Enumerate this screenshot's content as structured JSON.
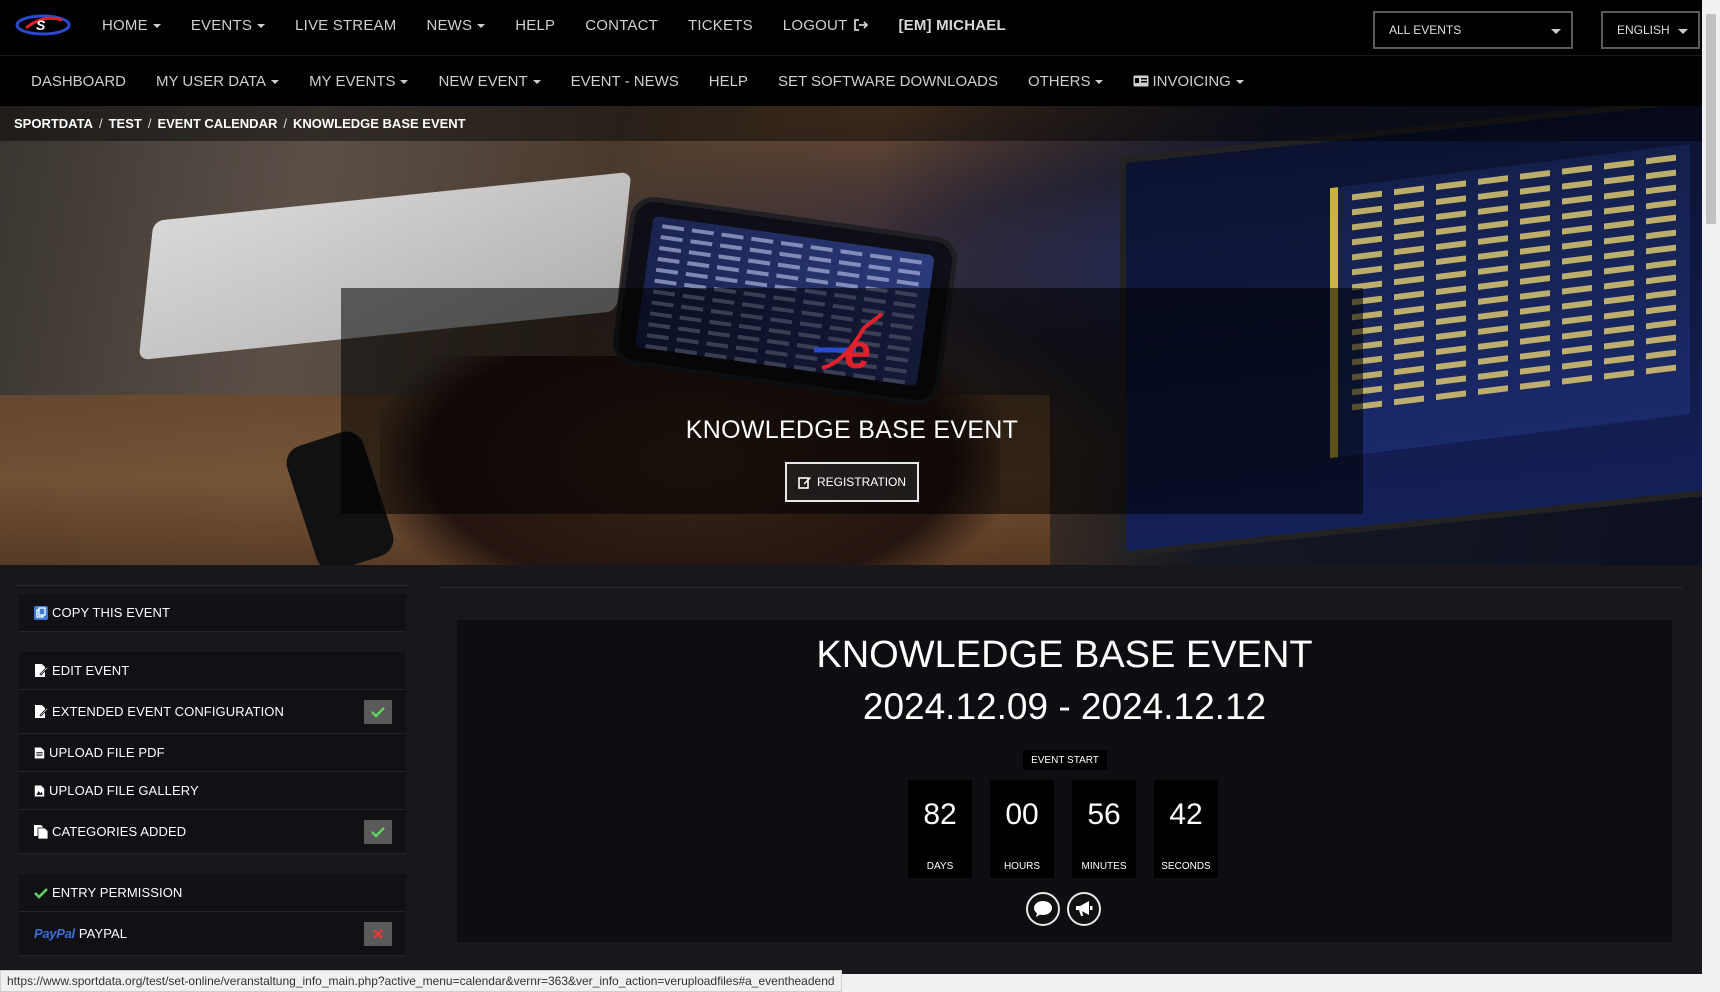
{
  "topnav": {
    "items": [
      "HOME",
      "EVENTS",
      "LIVE STREAM",
      "NEWS",
      "HELP",
      "CONTACT",
      "TICKETS",
      "LOGOUT",
      "[EM] MICHAEL"
    ],
    "event_select": "ALL EVENTS",
    "language_select": "ENGLISH"
  },
  "subnav": {
    "items": [
      "DASHBOARD",
      "MY USER DATA",
      "MY EVENTS",
      "NEW EVENT",
      "EVENT - NEWS",
      "HELP",
      "SET SOFTWARE DOWNLOADS",
      "OTHERS",
      "INVOICING"
    ]
  },
  "breadcrumb": [
    "SPORTDATA",
    "TEST",
    "EVENT CALENDAR",
    "KNOWLEDGE BASE EVENT"
  ],
  "hero": {
    "title": "KNOWLEDGE BASE EVENT",
    "registration_label": "REGISTRATION"
  },
  "left_panel": {
    "copy": "COPY THIS EVENT",
    "edit": "EDIT EVENT",
    "extended": "EXTENDED EVENT CONFIGURATION",
    "upload_pdf": "UPLOAD FILE PDF",
    "upload_gallery": "UPLOAD FILE GALLERY",
    "categories": "CATEGORIES ADDED",
    "entry_permission": "ENTRY PERMISSION",
    "paypal_logo": "PayPal",
    "paypal": "PAYPAL",
    "status": {
      "extended": "ok",
      "categories": "ok",
      "paypal": "missing"
    }
  },
  "event": {
    "title": "KNOWLEDGE BASE EVENT",
    "dates": "2024.12.09 - 2024.12.12",
    "start_label": "EVENT START",
    "countdown": [
      {
        "value": "82",
        "label": "DAYS"
      },
      {
        "value": "00",
        "label": "HOURS"
      },
      {
        "value": "56",
        "label": "MINUTES"
      },
      {
        "value": "42",
        "label": "SECONDS"
      }
    ]
  },
  "status_url": "https://www.sportdata.org/test/set-online/veranstaltung_info_main.php?active_menu=calendar&vernr=363&ver_info_action=veruploadfiles#a_eventheadend",
  "colors": {
    "brand_red": "#e0202a",
    "brand_blue": "#2a4ad0",
    "ok_green": "#5fd35f",
    "error_red": "#e03a3a"
  }
}
